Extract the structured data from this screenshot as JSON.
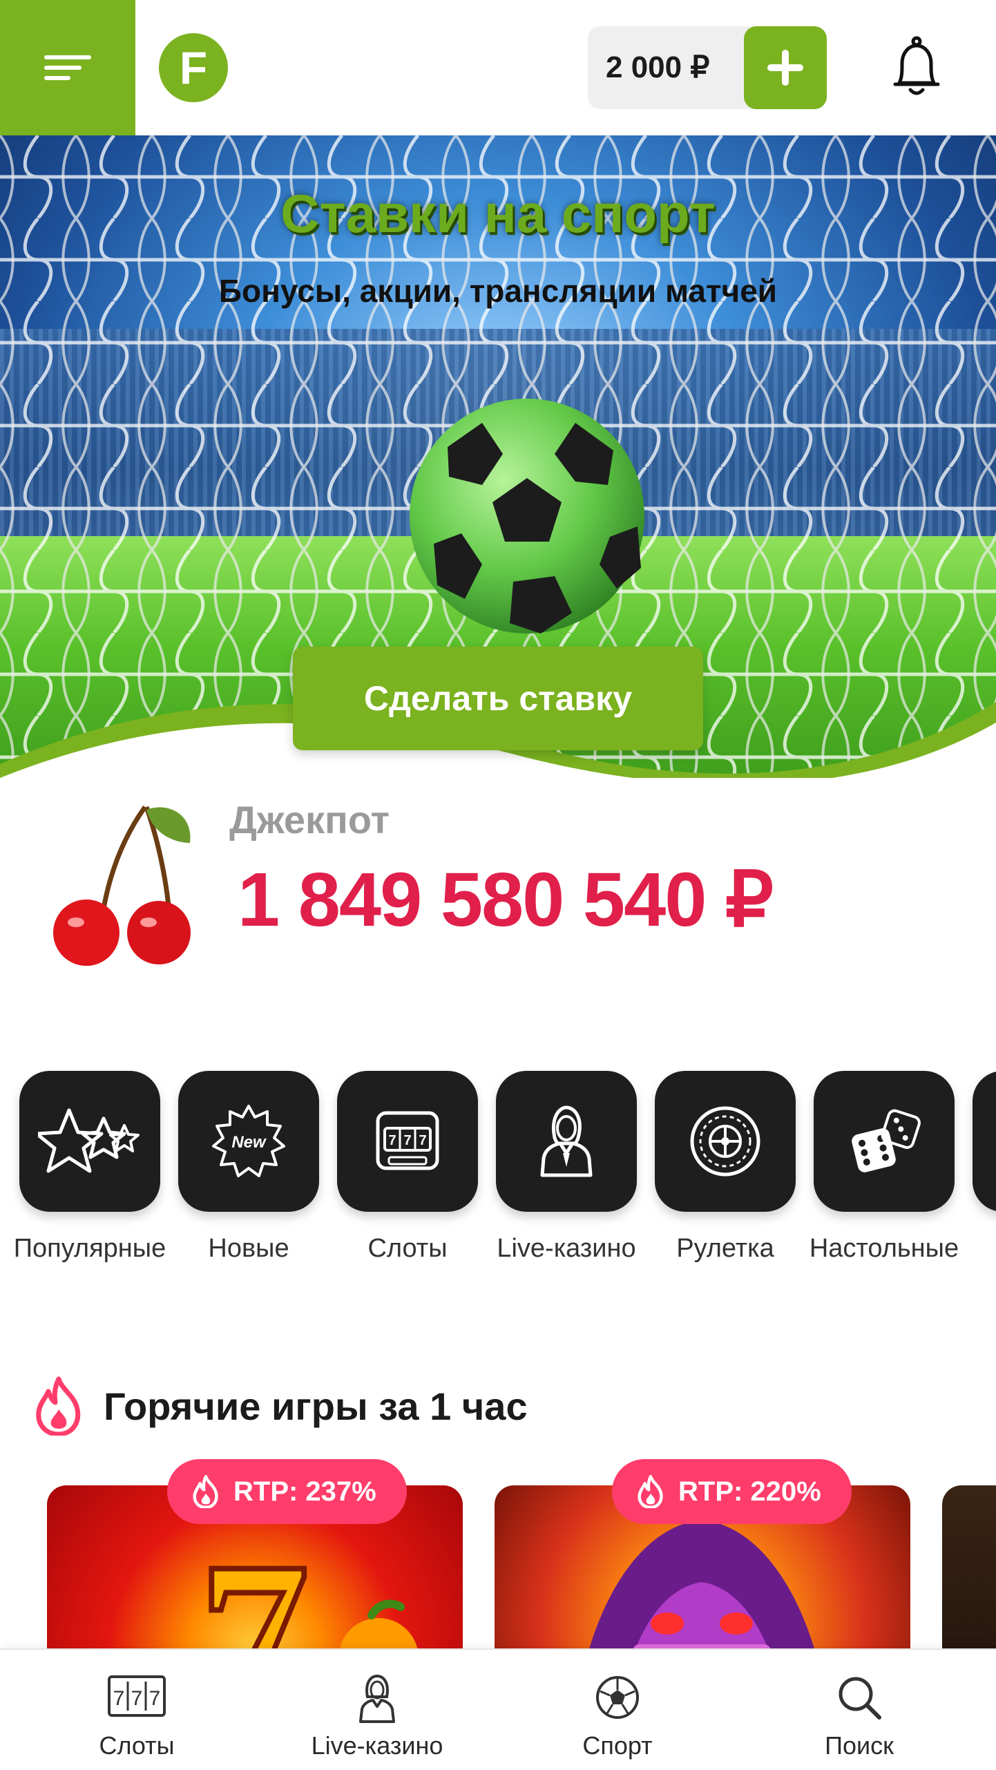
{
  "header": {
    "balance": "2 000 ₽",
    "logo_letter": "F"
  },
  "banner": {
    "title": "Ставки на спорт",
    "subtitle": "Бонусы, акции, трансляции матчей",
    "cta_label": "Сделать ставку"
  },
  "jackpot": {
    "label": "Джекпот",
    "value": "1 849 580 540 ₽"
  },
  "categories": [
    {
      "label": "Популярные",
      "icon": "stars-icon"
    },
    {
      "label": "Новые",
      "icon": "new-badge-icon"
    },
    {
      "label": "Слоты",
      "icon": "slot-machine-icon"
    },
    {
      "label": "Live-казино",
      "icon": "dealer-icon"
    },
    {
      "label": "Рулетка",
      "icon": "roulette-icon"
    },
    {
      "label": "Настольные",
      "icon": "dice-icon"
    }
  ],
  "hot_games": {
    "title": "Горячие игры за 1 час",
    "games": [
      {
        "rtp": "RTP: 237%"
      },
      {
        "rtp": "RTP: 220%"
      }
    ]
  },
  "bottom_nav": [
    {
      "label": "Слоты",
      "icon": "slot-machine-icon"
    },
    {
      "label": "Live-казино",
      "icon": "dealer-icon"
    },
    {
      "label": "Спорт",
      "icon": "soccer-ball-icon"
    },
    {
      "label": "Поиск",
      "icon": "search-icon"
    }
  ],
  "colors": {
    "brand_green": "#7bb21f",
    "jackpot_red": "#e0204a",
    "rtp_pink": "#ff3d6b",
    "tile_dark": "#1e1e1e"
  }
}
